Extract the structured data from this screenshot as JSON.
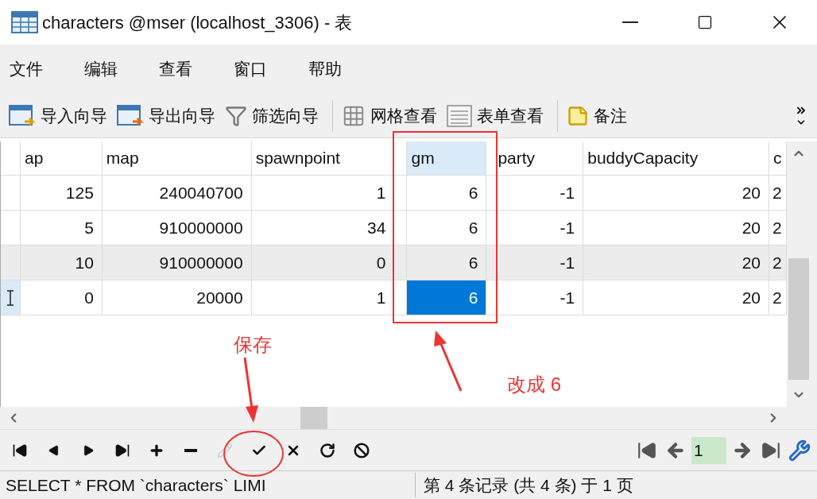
{
  "window": {
    "title": "characters @mser (localhost_3306) - 表"
  },
  "menu": [
    "文件",
    "编辑",
    "查看",
    "窗口",
    "帮助"
  ],
  "toolbar": [
    {
      "kind": "import",
      "label": "导入向导"
    },
    {
      "kind": "export",
      "label": "导出向导"
    },
    {
      "kind": "filter",
      "label": "筛选向导"
    },
    {
      "kind": "grid",
      "label": "网格查看"
    },
    {
      "kind": "form",
      "label": "表单查看"
    },
    {
      "kind": "note",
      "label": "备注"
    }
  ],
  "table": {
    "columns": [
      {
        "label": "ap",
        "selected": false
      },
      {
        "label": "map",
        "selected": false
      },
      {
        "label": "spawnpoint",
        "selected": false
      },
      {
        "label": "gm",
        "selected": true
      },
      {
        "label": "party",
        "selected": false
      },
      {
        "label": "buddyCapacity",
        "selected": false
      },
      {
        "label": "c",
        "selected": false
      }
    ],
    "rows": [
      {
        "current": false,
        "shaded": false,
        "cells": [
          {
            "text": "125",
            "selected": false
          },
          {
            "text": "240040700",
            "selected": false
          },
          {
            "text": "1",
            "selected": false
          },
          {
            "text": "6",
            "selected": false
          },
          {
            "text": "-1",
            "selected": false
          },
          {
            "text": "20",
            "selected": false
          },
          {
            "text": "2",
            "selected": false
          }
        ]
      },
      {
        "current": false,
        "shaded": false,
        "cells": [
          {
            "text": "5",
            "selected": false
          },
          {
            "text": "910000000",
            "selected": false
          },
          {
            "text": "34",
            "selected": false
          },
          {
            "text": "6",
            "selected": false
          },
          {
            "text": "-1",
            "selected": false
          },
          {
            "text": "20",
            "selected": false
          },
          {
            "text": "2",
            "selected": false
          }
        ]
      },
      {
        "current": false,
        "shaded": true,
        "cells": [
          {
            "text": "10",
            "selected": false
          },
          {
            "text": "910000000",
            "selected": false
          },
          {
            "text": "0",
            "selected": false
          },
          {
            "text": "6",
            "selected": false
          },
          {
            "text": "-1",
            "selected": false
          },
          {
            "text": "20",
            "selected": false
          },
          {
            "text": "2",
            "selected": false
          }
        ]
      },
      {
        "current": true,
        "shaded": false,
        "cells": [
          {
            "text": "0",
            "selected": false
          },
          {
            "text": "20000",
            "selected": false
          },
          {
            "text": "1",
            "selected": false
          },
          {
            "text": "6",
            "selected": true
          },
          {
            "text": "-1",
            "selected": false
          },
          {
            "text": "20",
            "selected": false
          },
          {
            "text": "2",
            "selected": false
          }
        ]
      }
    ]
  },
  "navigator": [
    {
      "kind": "first",
      "disabled": false
    },
    {
      "kind": "prev",
      "disabled": false
    },
    {
      "kind": "next",
      "disabled": false
    },
    {
      "kind": "last",
      "disabled": false
    },
    {
      "kind": "add",
      "disabled": false
    },
    {
      "kind": "delete",
      "disabled": false
    },
    {
      "kind": "edit",
      "disabled": true
    },
    {
      "kind": "apply",
      "disabled": false
    },
    {
      "kind": "cancel",
      "disabled": false
    },
    {
      "kind": "refresh",
      "disabled": false
    },
    {
      "kind": "stop",
      "disabled": false
    }
  ],
  "pager": {
    "page": "1"
  },
  "status_bar": {
    "query": "SELECT * FROM `characters` LIMI",
    "records": "第 4 条记录 (共 4 条) 于 1 页"
  },
  "annotations": {
    "save_label": "保存",
    "change_label": "改成 6"
  }
}
